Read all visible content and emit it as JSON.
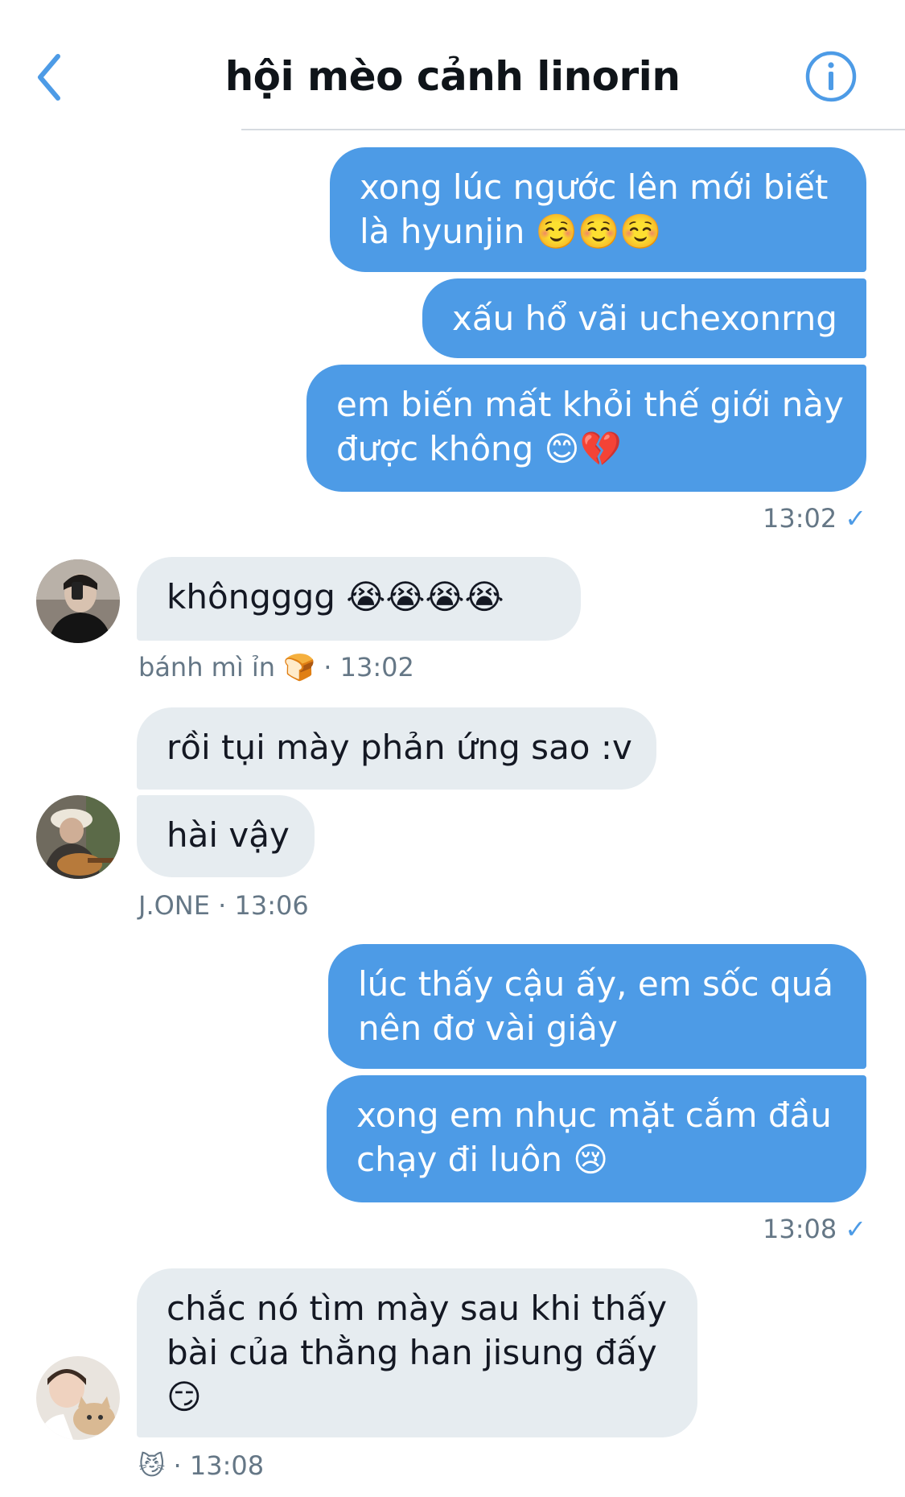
{
  "header": {
    "title": "hội mèo cảnh linorin",
    "back_icon": "chevron-left-icon",
    "info_icon": "info-icon",
    "accent": "#4d9be6"
  },
  "colors": {
    "sent_bubble": "#4d9be6",
    "received_bubble": "#e6ecf0",
    "meta_text": "#657786"
  },
  "messages": {
    "m1": {
      "line1": "xong lúc ngước lên mới biết",
      "line2": "là hyunjin ☺️☺️☺️"
    },
    "m2": {
      "text": "xấu hổ vãi uchexonrng"
    },
    "m3": {
      "line1": "em biến mất khỏi thế giới này",
      "line2": "được không 😊💔"
    },
    "m3_time": "13:02",
    "m4": {
      "text": "khôngggg 😭😭😭😭"
    },
    "m4_meta": {
      "name": "bánh mì ỉn 🍞",
      "time": "· 13:02"
    },
    "m5": {
      "text": "rồi tụi mày phản ứng sao :v"
    },
    "m6": {
      "text": "hài vậy"
    },
    "m6_meta": {
      "name": "J.ONE",
      "time": "· 13:06"
    },
    "m7": {
      "line1": "lúc thấy cậu ấy, em sốc quá",
      "line2": "nên đơ vài giây"
    },
    "m8": {
      "line1": "xong em nhục mặt cắm đầu",
      "line2": "chạy đi luôn 😢"
    },
    "m8_time": "13:08",
    "m9": {
      "line1": "chắc nó tìm mày sau khi thấy",
      "line2": "bài của thằng han jisung đấy",
      "line3": "😏"
    },
    "m9_meta": {
      "name": "😼",
      "time": "· 13:08"
    }
  },
  "read_icon": "checkmark-icon"
}
